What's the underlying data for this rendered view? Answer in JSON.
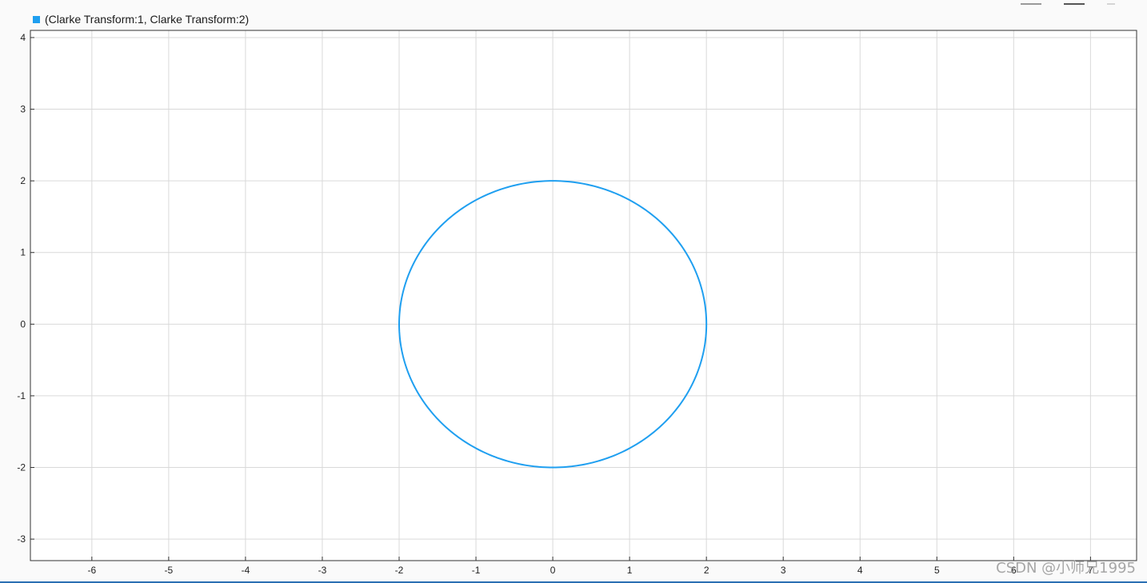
{
  "legend": {
    "label": "(Clarke Transform:1, Clarke Transform:2)",
    "color": "#1f9ff0"
  },
  "watermark": "CSDN @小师兄1995",
  "icons": [
    "zoom-icon",
    "pan-icon",
    "fit-icon",
    "more-icon"
  ],
  "chart_data": {
    "type": "line",
    "title": "",
    "xlabel": "",
    "ylabel": "",
    "xlim": [
      -6.8,
      7.6
    ],
    "ylim": [
      -3.3,
      4.1
    ],
    "xticks": [
      -6,
      -5,
      -4,
      -3,
      -2,
      -1,
      0,
      1,
      2,
      3,
      4,
      5,
      6,
      7
    ],
    "yticks": [
      -3,
      -2,
      -1,
      0,
      1,
      2,
      3,
      4
    ],
    "grid": true,
    "series": [
      {
        "name": "(Clarke Transform:1, Clarke Transform:2)",
        "color": "#1f9ff0",
        "shape": "circle",
        "center": [
          0,
          0
        ],
        "radius": 2
      }
    ]
  }
}
